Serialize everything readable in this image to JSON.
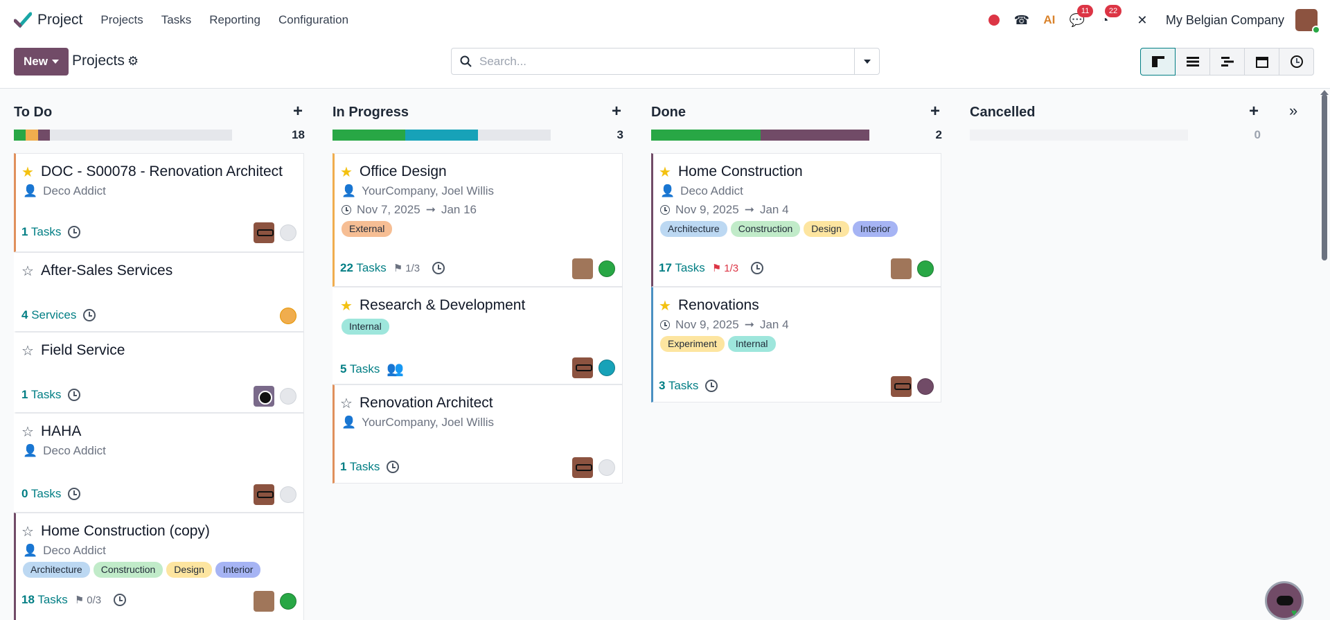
{
  "navbar": {
    "app_name": "Project",
    "menu": [
      "Projects",
      "Tasks",
      "Reporting",
      "Configuration"
    ],
    "badges": {
      "messages": "11",
      "activities": "22"
    },
    "company": "My Belgian Company"
  },
  "control": {
    "new_label": "New",
    "breadcrumb": "Projects",
    "search_placeholder": "Search..."
  },
  "columns": [
    {
      "title": "To Do",
      "count": "18",
      "progress": [
        {
          "color": "#28a745",
          "pct": 5.5
        },
        {
          "color": "#f0ad4e",
          "pct": 5.5
        },
        {
          "color": "#714b67",
          "pct": 5.5
        }
      ]
    },
    {
      "title": "In Progress",
      "count": "3",
      "progress": [
        {
          "color": "#28a745",
          "pct": 33.3
        },
        {
          "color": "#17a2b8",
          "pct": 33.3
        }
      ]
    },
    {
      "title": "Done",
      "count": "2",
      "progress": [
        {
          "color": "#28a745",
          "pct": 50
        },
        {
          "color": "#714b67",
          "pct": 50
        }
      ]
    },
    {
      "title": "Cancelled",
      "count": "0",
      "progress": []
    }
  ],
  "cards": {
    "todo": [
      {
        "title": "DOC - S00078 - Renovation Architect",
        "partner": "Deco Addict",
        "count": "1",
        "unit": "Tasks"
      },
      {
        "title": "After-Sales Services",
        "count": "4",
        "unit": "Services"
      },
      {
        "title": "Field Service",
        "count": "1",
        "unit": "Tasks"
      },
      {
        "title": "HAHA",
        "partner": "Deco Addict",
        "count": "0",
        "unit": "Tasks"
      },
      {
        "title": "Home Construction (copy)",
        "partner": "Deco Addict",
        "tags": [
          "Architecture",
          "Construction",
          "Design",
          "Interior"
        ],
        "count": "18",
        "unit": "Tasks",
        "milestone": "0/3"
      }
    ],
    "inprogress": [
      {
        "title": "Office Design",
        "partner": "YourCompany, Joel Willis",
        "date_start": "Nov 7, 2025",
        "date_end": "Jan 16",
        "tags": [
          "External"
        ],
        "count": "22",
        "unit": "Tasks",
        "milestone": "1/3"
      },
      {
        "title": "Research & Development",
        "tags": [
          "Internal"
        ],
        "count": "5",
        "unit": "Tasks"
      },
      {
        "title": "Renovation Architect",
        "partner": "YourCompany, Joel Willis",
        "count": "1",
        "unit": "Tasks"
      }
    ],
    "done": [
      {
        "title": "Home Construction",
        "partner": "Deco Addict",
        "date_start": "Nov 9, 2025",
        "date_end": "Jan 4",
        "tags": [
          "Architecture",
          "Construction",
          "Design",
          "Interior"
        ],
        "count": "17",
        "unit": "Tasks",
        "milestone": "1/3"
      },
      {
        "title": "Renovations",
        "date_start": "Nov 9, 2025",
        "date_end": "Jan 4",
        "tags": [
          "Experiment",
          "Internal"
        ],
        "count": "3",
        "unit": "Tasks"
      }
    ]
  },
  "colors": {
    "brand": "#714b67",
    "link": "#017e84",
    "star": "#f3c111"
  }
}
